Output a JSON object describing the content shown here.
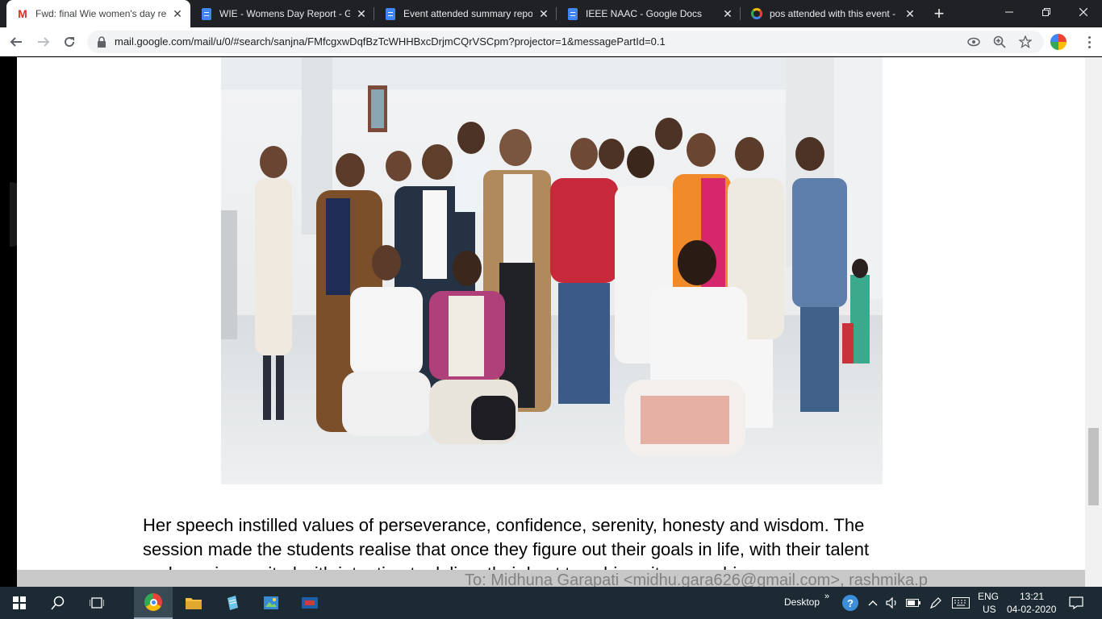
{
  "browser": {
    "tabs": [
      {
        "title": "Fwd: final Wie women's day re",
        "icon": "gmail-icon",
        "active": true
      },
      {
        "title": "WIE - Womens Day Report - G",
        "icon": "docs-icon",
        "active": false
      },
      {
        "title": "Event attended summary repor",
        "icon": "docs-icon",
        "active": false
      },
      {
        "title": "IEEE NAAC - Google Docs",
        "icon": "docs-icon",
        "active": false
      },
      {
        "title": "pos attended with this event -",
        "icon": "google-icon",
        "active": false
      }
    ],
    "url": "mail.google.com/mail/u/0/#search/sanjna/FMfcgxwDqfBzTcWHHBxcDrjmCQrVSCpm?projector=1&messagePartId=0.1"
  },
  "document": {
    "paragraph_lines": [
      "Her speech instilled values of perseverance, confidence, serenity, honesty and wisdom. The",
      "session made the students realise that once they figure out their goals in life, with their talent",
      "and passion, united with intention to deliver their best to achieve it, one achieves success."
    ],
    "ghost_recipients": "To: Midhuna Garapati <midhu.gara626@gmail.com>, rashmika.p"
  },
  "taskbar": {
    "desktop_label": "Desktop",
    "language": "ENG",
    "region": "US",
    "time": "13:21",
    "date": "04-02-2020"
  },
  "colors": {
    "tabstrip": "#202124",
    "taskbar": "#1b2a33",
    "gmail_red": "#d93025",
    "docs_blue": "#4285f4"
  }
}
